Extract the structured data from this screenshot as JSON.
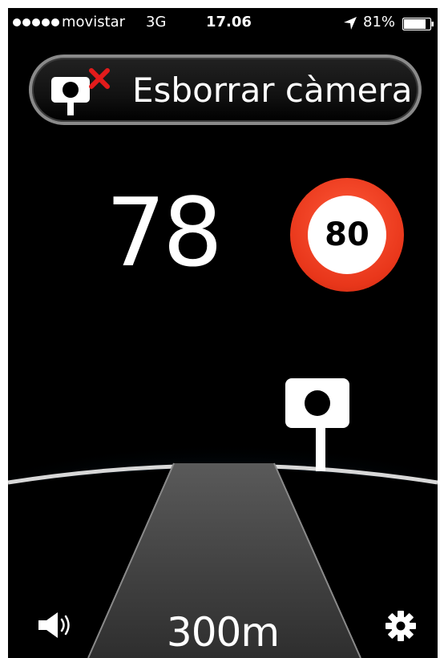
{
  "status_bar": {
    "carrier": "movistar",
    "network": "3G",
    "time": "17.06",
    "battery": "81%"
  },
  "delete_button": {
    "label": "Esborrar càmera",
    "icon": "camera-delete-icon"
  },
  "speed": {
    "current": "78",
    "limit": "80"
  },
  "distance": "300m",
  "footer": {
    "sound_icon": "speaker-icon",
    "settings_icon": "gear-icon"
  },
  "colors": {
    "background": "#000000",
    "limit_ring": "#e8361a",
    "horizon_glow": "#2aa8e0",
    "delete_x": "#e21b1b"
  }
}
